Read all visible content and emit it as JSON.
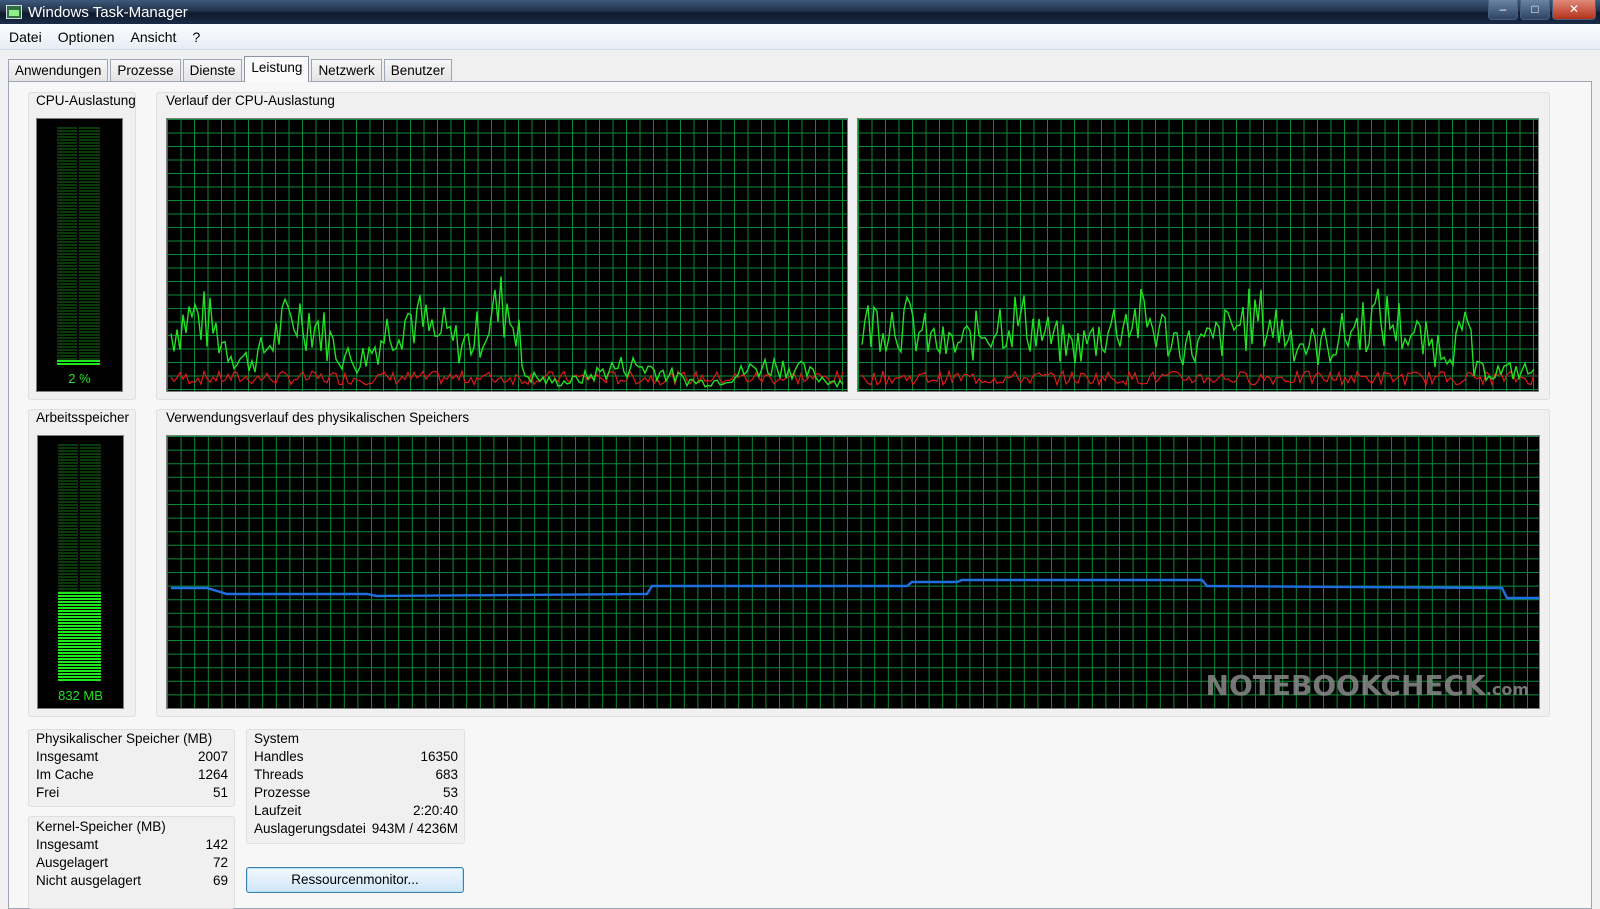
{
  "window": {
    "title": "Windows Task-Manager"
  },
  "menu": [
    "Datei",
    "Optionen",
    "Ansicht",
    "?"
  ],
  "tabs": [
    {
      "label": "Anwendungen",
      "active": false
    },
    {
      "label": "Prozesse",
      "active": false
    },
    {
      "label": "Dienste",
      "active": false
    },
    {
      "label": "Leistung",
      "active": true
    },
    {
      "label": "Netzwerk",
      "active": false
    },
    {
      "label": "Benutzer",
      "active": false
    }
  ],
  "cpu": {
    "label": "CPU-Auslastung",
    "value_text": "2 %",
    "percent": 2
  },
  "cpu_history": {
    "label": "Verlauf der CPU-Auslastung"
  },
  "memory": {
    "label": "Arbeitsspeicher",
    "value_text": "832 MB",
    "fill_fraction": 0.38
  },
  "memory_history": {
    "label": "Verwendungsverlauf des physikalischen Speichers"
  },
  "watermark": {
    "main": "NOTEBOOKCHECK",
    "suffix": ".com"
  },
  "physical": {
    "title": "Physikalischer Speicher (MB)",
    "rows": [
      {
        "label": "Insgesamt",
        "value": "2007"
      },
      {
        "label": "Im Cache",
        "value": "1264"
      },
      {
        "label": "Frei",
        "value": "51"
      }
    ]
  },
  "kernel": {
    "title": "Kernel-Speicher (MB)",
    "rows": [
      {
        "label": "Insgesamt",
        "value": "142"
      },
      {
        "label": "Ausgelagert",
        "value": "72"
      },
      {
        "label": "Nicht ausgelagert",
        "value": "69"
      }
    ]
  },
  "system": {
    "title": "System",
    "rows": [
      {
        "label": "Handles",
        "value": "16350"
      },
      {
        "label": "Threads",
        "value": "683"
      },
      {
        "label": "Prozesse",
        "value": "53"
      },
      {
        "label": "Laufzeit",
        "value": "2:20:40"
      },
      {
        "label": "Auslagerungsdatei",
        "value": "943M / 4236M"
      }
    ]
  },
  "buttons": {
    "resource_monitor": "Ressourcenmonitor..."
  },
  "colors": {
    "grid": "#0a8a3a",
    "cpu_total": "#22e022",
    "cpu_kernel": "#e01818",
    "memory_line": "#1f6fe0"
  }
}
